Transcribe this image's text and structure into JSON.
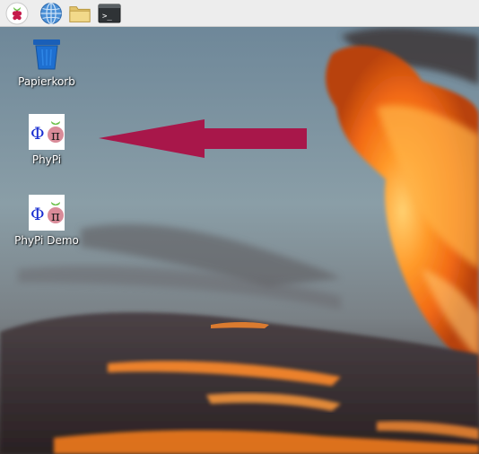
{
  "taskbar": {
    "items": [
      {
        "name": "raspberry-menu",
        "icon": "raspberry-icon"
      },
      {
        "name": "web-browser",
        "icon": "globe-icon"
      },
      {
        "name": "file-manager",
        "icon": "folder-icon"
      },
      {
        "name": "terminal",
        "icon": "terminal-icon",
        "glyph": ">_"
      }
    ]
  },
  "desktop": {
    "icons": [
      {
        "label": "Papierkorb",
        "icon": "trash-icon"
      },
      {
        "label": "PhyPi",
        "icon": "phypi-icon",
        "glyph_left": "Φ",
        "glyph_right": "π"
      },
      {
        "label": "PhyPi Demo",
        "icon": "phypi-icon",
        "glyph_left": "Φ",
        "glyph_right": "π"
      }
    ]
  },
  "colors": {
    "taskbar_bg": "#ededed",
    "annotation_arrow": "#a8174a",
    "phi_blue": "#1a2fd1",
    "raspberry_red": "#c51a4a",
    "leaf_green": "#6cc04a",
    "trash_blue": "#1e6fd0"
  }
}
